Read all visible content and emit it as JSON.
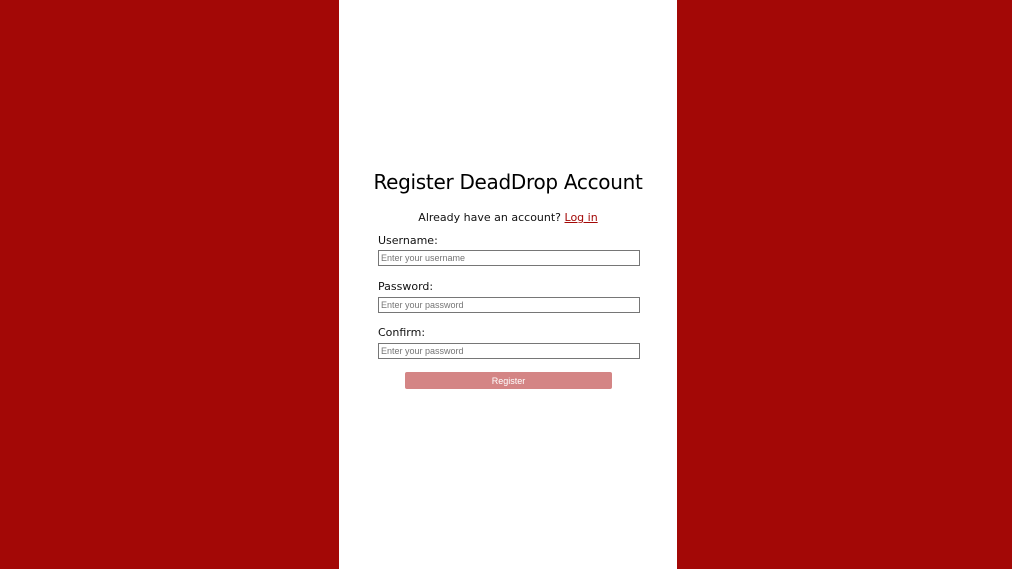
{
  "colors": {
    "side_background": "#a30806",
    "panel_background": "#ffffff",
    "link": "#a30806",
    "button_background": "#d48585",
    "button_text": "#ffffff"
  },
  "form": {
    "title": "Register DeadDrop Account",
    "already_text": "Already have an account?",
    "login_link": "Log in",
    "username": {
      "label": "Username:",
      "placeholder": "Enter your username",
      "value": ""
    },
    "password": {
      "label": "Password:",
      "placeholder": "Enter your password",
      "value": ""
    },
    "confirm": {
      "label": "Confirm:",
      "placeholder": "Enter your password",
      "value": ""
    },
    "register_label": "Register"
  }
}
